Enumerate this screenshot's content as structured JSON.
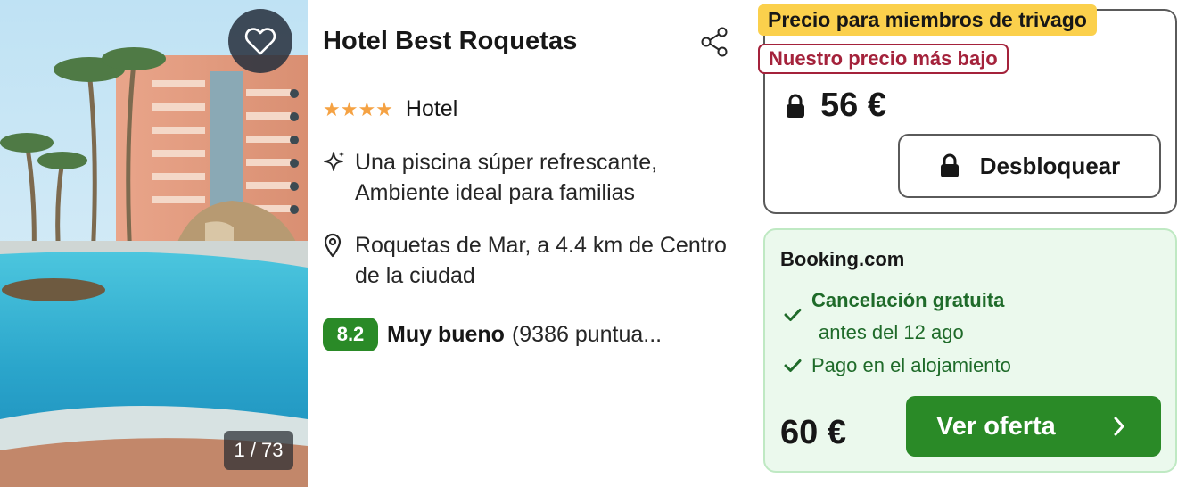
{
  "gallery": {
    "counter": "1 / 73",
    "favorite_icon": "heart-outline-icon"
  },
  "hotel": {
    "name": "Hotel Best Roquetas",
    "star_count": 4,
    "stars_display": "★★★★",
    "accommodation_type": "Hotel",
    "highlights": "Una piscina súper refrescante, Ambiente ideal para familias",
    "location": "Roquetas de Mar, a 4.4 km de Centro de la ciudad",
    "rating": {
      "score": "8.2",
      "label": "Muy bueno",
      "reviews": "(9386 puntua..."
    }
  },
  "member_offer": {
    "badge": "Precio para miembros de trivago",
    "lowest_badge": "Nuestro precio más bajo",
    "price": "56 €",
    "unlock_label": "Desbloquear"
  },
  "deal": {
    "provider": "Booking.com",
    "perks": {
      "cancellation_title": "Cancelación gratuita",
      "cancellation_sub": "antes del 12 ago",
      "payment": "Pago en el alojamiento"
    },
    "price": "60 €",
    "cta_label": "Ver oferta"
  },
  "colors": {
    "star": "#f5a243",
    "rating_badge": "#2a8a27",
    "member_badge": "#fbd04c",
    "lowest_price": "#a4223b",
    "offer_bg": "#ebf9ed",
    "cta": "#2a8a27"
  }
}
